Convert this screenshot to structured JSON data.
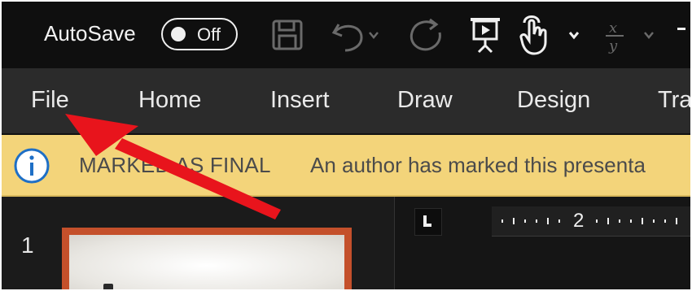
{
  "titlebar": {
    "autosave_label": "AutoSave",
    "autosave_state": "Off",
    "icons": [
      "save-icon",
      "undo-icon",
      "redo-icon",
      "present-icon",
      "touch-mode-icon",
      "equation-icon",
      "more-icon"
    ]
  },
  "ribbon": {
    "tabs": [
      {
        "label": "File"
      },
      {
        "label": "Home"
      },
      {
        "label": "Insert"
      },
      {
        "label": "Draw"
      },
      {
        "label": "Design"
      },
      {
        "label": "Tra"
      }
    ]
  },
  "message_bar": {
    "title": "MARKED AS FINAL",
    "text": "An author has marked this presenta"
  },
  "workspace": {
    "slide_number": "1",
    "ruler_number": "2"
  },
  "colors": {
    "message_bar": "#f3d47a",
    "annotation_arrow": "#e8141c",
    "slide_border": "#c4502b"
  }
}
